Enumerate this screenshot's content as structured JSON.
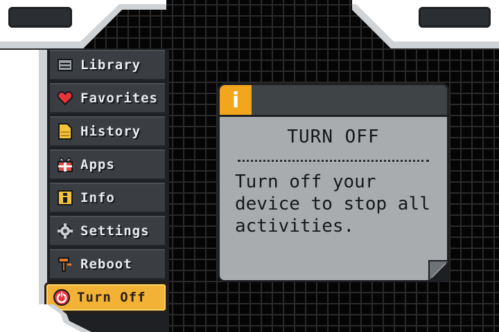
{
  "menu": {
    "items": [
      {
        "label": "Library",
        "icon": "library-icon"
      },
      {
        "label": "Favorites",
        "icon": "heart-icon"
      },
      {
        "label": "History",
        "icon": "history-icon"
      },
      {
        "label": "Apps",
        "icon": "gift-icon"
      },
      {
        "label": "Info",
        "icon": "info-icon"
      },
      {
        "label": "Settings",
        "icon": "gear-icon"
      },
      {
        "label": "Reboot",
        "icon": "hammer-icon"
      },
      {
        "label": "Turn Off",
        "icon": "power-icon",
        "selected": true
      }
    ]
  },
  "panel": {
    "icon_glyph": "i",
    "title": "TURN OFF",
    "description": "Turn off your device to stop all activities."
  },
  "colors": {
    "accent": "#f2b235",
    "info_badge": "#f2a61e",
    "panel_bg": "#a9acaf",
    "menu_item_bg": "#3a3e42"
  }
}
